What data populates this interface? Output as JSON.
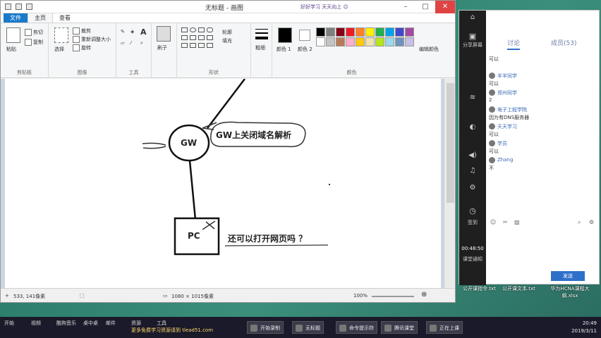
{
  "paint": {
    "title": "无标题 - 画图",
    "banner": "好好学习 天天向上 ☺",
    "tabs": [
      "文件",
      "主页",
      "查看"
    ],
    "clipboard": {
      "paste": "粘贴",
      "cut": "剪切",
      "copy": "复制",
      "label": "剪贴板"
    },
    "image": {
      "select": "选择",
      "crop": "裁剪",
      "resize": "重新调整大小",
      "rotate": "旋转",
      "label": "图像"
    },
    "tools": {
      "label": "工具",
      "text_glyph": "A"
    },
    "brush": {
      "label": "刷子"
    },
    "shapes": {
      "outline": "轮廓",
      "fill": "填充",
      "label": "形状"
    },
    "size": {
      "label": "粗细"
    },
    "colors": {
      "color1": "颜色 1",
      "color2": "颜色 2",
      "edit": "编辑颜色",
      "label": "颜色",
      "palette": [
        "#000000",
        "#7f7f7f",
        "#880015",
        "#ed1c24",
        "#ff7f27",
        "#fff200",
        "#22b14c",
        "#00a2e8",
        "#3f48cc",
        "#a349a4",
        "#ffffff",
        "#c3c3c3",
        "#b97a57",
        "#ffaec9",
        "#ffc90e",
        "#efe4b0",
        "#b5e61d",
        "#99d9ea",
        "#7092be",
        "#c8bfe7"
      ]
    },
    "diagram": {
      "gw_label": "GW",
      "gw_note": "GW上关闭域名解析",
      "pc_label": "PC",
      "question": "还可以打开网页吗 ？"
    },
    "status": {
      "coords": "533, 141像素",
      "dimensions": "1080 × 1015像素",
      "zoom": "100%"
    }
  },
  "chat": {
    "side": {
      "share_screen": "分享屏幕",
      "time": "00:48:50",
      "footer": "课堂通知",
      "signin": "签到"
    },
    "tabs": {
      "discuss": "讨论",
      "members": "成员(53)"
    },
    "messages": [
      {
        "name": "",
        "text": "可以"
      },
      {
        "name": "羊羊同学",
        "text": "可以"
      },
      {
        "name": "郑州同学",
        "text": "2"
      },
      {
        "name": "电子工程学院",
        "text": "因为有DNS服务器"
      },
      {
        "name": "天天学习",
        "text": "可以"
      },
      {
        "name": "学员",
        "text": "可以"
      },
      {
        "name": "Zhang",
        "text": "不"
      }
    ],
    "send": "发送"
  },
  "desktop_files": [
    "公开课指令.txt",
    "公开课文本.txt",
    "华为HCNA课程大纲.xlsx"
  ],
  "taskbar": {
    "items": [
      "开始",
      "视频",
      "酷狗音乐",
      "桌中桌",
      "邮件",
      "资源",
      "工具"
    ],
    "watermark": "更多免费学习资源请到 tlead51.com",
    "apps": [
      "开始录制",
      "无标题",
      "命令提示符",
      "腾讯课堂",
      "正在上课"
    ],
    "time": "20:49",
    "date": "2019/3/11"
  }
}
